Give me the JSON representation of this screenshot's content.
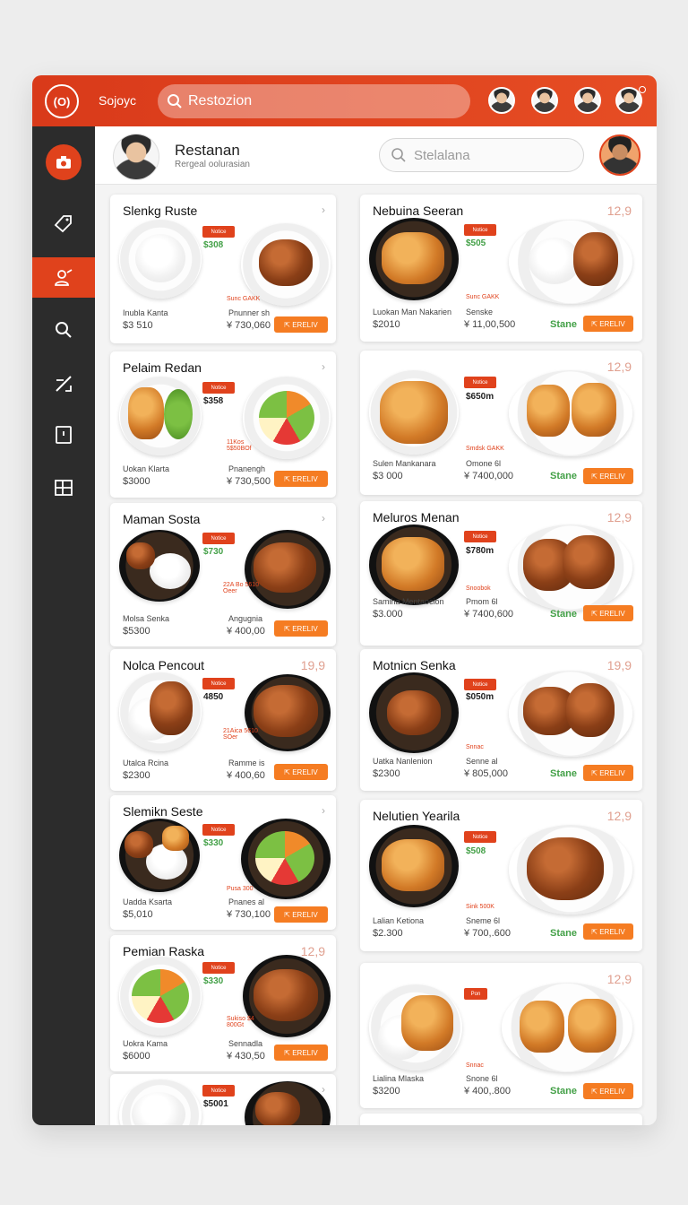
{
  "app": {
    "logo_text": "(O)",
    "brand": "Sojoyc",
    "search_placeholder": "Restozion"
  },
  "header": {
    "title": "Restanan",
    "subtitle": "Rergeal oolurasian",
    "search_placeholder": "Stelalana"
  },
  "sidebar": {
    "items": [
      {
        "icon": "camera-icon"
      },
      {
        "icon": "tag-icon"
      },
      {
        "icon": "chef-icon",
        "active": true
      },
      {
        "icon": "search-icon"
      },
      {
        "icon": "edit-icon"
      },
      {
        "icon": "calendar-icon"
      },
      {
        "icon": "grid-icon"
      }
    ]
  },
  "colors": {
    "accent": "#e0421c",
    "sidebar": "#2c2c2c",
    "button": "#f57c22",
    "price_green": "#43a047"
  },
  "cards_left": [
    {
      "title": "Slenkg Ruste",
      "tag": "Notice",
      "green_price": "$308",
      "small": "Sunc GAKK",
      "l1": "Inubla Kanta",
      "l2": "$3 510",
      "r1": "Pnunner sh",
      "r2": "¥ 730,060",
      "button": "⇱ ERELIV"
    },
    {
      "title": "Pelaim Redan",
      "tag": "Notice",
      "green_price": "$358",
      "small": "11Kos 5$50BOf",
      "l1": "Uokan Klarta",
      "l2": "$3000",
      "r1": "Pnanengh",
      "r2": "¥ 730,500",
      "button": "⇱ ERELIV"
    },
    {
      "title": "Maman Sosta",
      "tag": "Notice",
      "green_price": "$730",
      "small": "22A Bo 5610 Oeer",
      "l1": "Molsa Senka",
      "l2": "$5300",
      "r1": "Angugnia",
      "r2": "¥ 400,00",
      "button": "⇱ ERELIV"
    },
    {
      "title": "Nolca Pencout",
      "price": "19,9",
      "tag": "Notice",
      "green_price": "4850",
      "small": "21Aica 5610 SOer",
      "l1": "Utalca Rcina",
      "l2": "$2300",
      "r1": "Ramme is",
      "r2": "¥ 400,60",
      "button": "⇱ ERELIV"
    },
    {
      "title": "Slemikn Seste",
      "tag": "Notice",
      "green_price": "$330",
      "small": "Pusa 300",
      "l1": "Uadda Ksarta",
      "l2": "$5,010",
      "r1": "Pnanes al",
      "r2": "¥ 730,100",
      "button": "⇱ ERELIV"
    },
    {
      "title": "Pemian Raska",
      "price": "12,9",
      "tag": "Notice",
      "green_price": "$330",
      "small": "Sukiso $4 800Gt",
      "l1": "Uokra Kama",
      "l2": "$6000",
      "r1": "Sennadla",
      "r2": "¥ 430,50",
      "button": "⇱ ERELIV"
    },
    {
      "title": "",
      "tag": "Notice",
      "green_price": "$5001"
    }
  ],
  "cards_right": [
    {
      "title": "Nebuina Seeran",
      "price": "12,9",
      "tag": "Notice",
      "green_price": "$505",
      "small": "Sunc GAKK",
      "l1": "Luokan Man Nakarien",
      "l2": "$2010",
      "r1": "Senske",
      "r2": "¥ 11,00,500",
      "stane": "Stane",
      "button": "⇱ ERELIV"
    },
    {
      "title": "",
      "price": "12,9",
      "tag": "Notice",
      "green_price": "$650m",
      "small": "Smdsk GAKK",
      "l1": "Sulen Mankanara",
      "l2": "$3 000",
      "r1": "Omone 6l",
      "r2": "¥ 7400,000",
      "stane": "Stane",
      "button": "⇱ ERELIV"
    },
    {
      "title": "Meluros Menan",
      "price": "12,9",
      "tag": "Notice",
      "green_price": "$780m",
      "small": "Snoobok",
      "l1": "Samiha Mentaocion",
      "l2": "$3.000",
      "r1": "Pmom 6l",
      "r2": "¥ 7400,600",
      "stane": "Stane",
      "button": "⇱ ERELIV"
    },
    {
      "title": "Motnicn Senka",
      "price": "19,9",
      "tag": "Notice",
      "green_price": "$050m",
      "small": "Snnac",
      "l1": "Uatka Nanlenion",
      "l2": "$2300",
      "r1": "Senne al",
      "r2": "¥ 805,000",
      "stane": "Stane",
      "button": "⇱ ERELIV"
    },
    {
      "title": "Nelutien Yearila",
      "price": "12,9",
      "tag": "Notice",
      "green_price": "$508",
      "small": "Sink 500K",
      "l1": "Lalian Ketiona",
      "l2": "$2.300",
      "r1": "Sneme 6l",
      "r2": "¥ 700,.600",
      "stane": "Stane",
      "button": "⇱ ERELIV"
    },
    {
      "title": "",
      "price": "12,9",
      "tag": "Pon",
      "small": "Snnac",
      "l1": "Lialina Mlaska",
      "l2": "$3200",
      "r1": "Snone 6l",
      "r2": "¥ 400,.800",
      "stane": "Stane",
      "button": "⇱ ERELIV"
    }
  ]
}
